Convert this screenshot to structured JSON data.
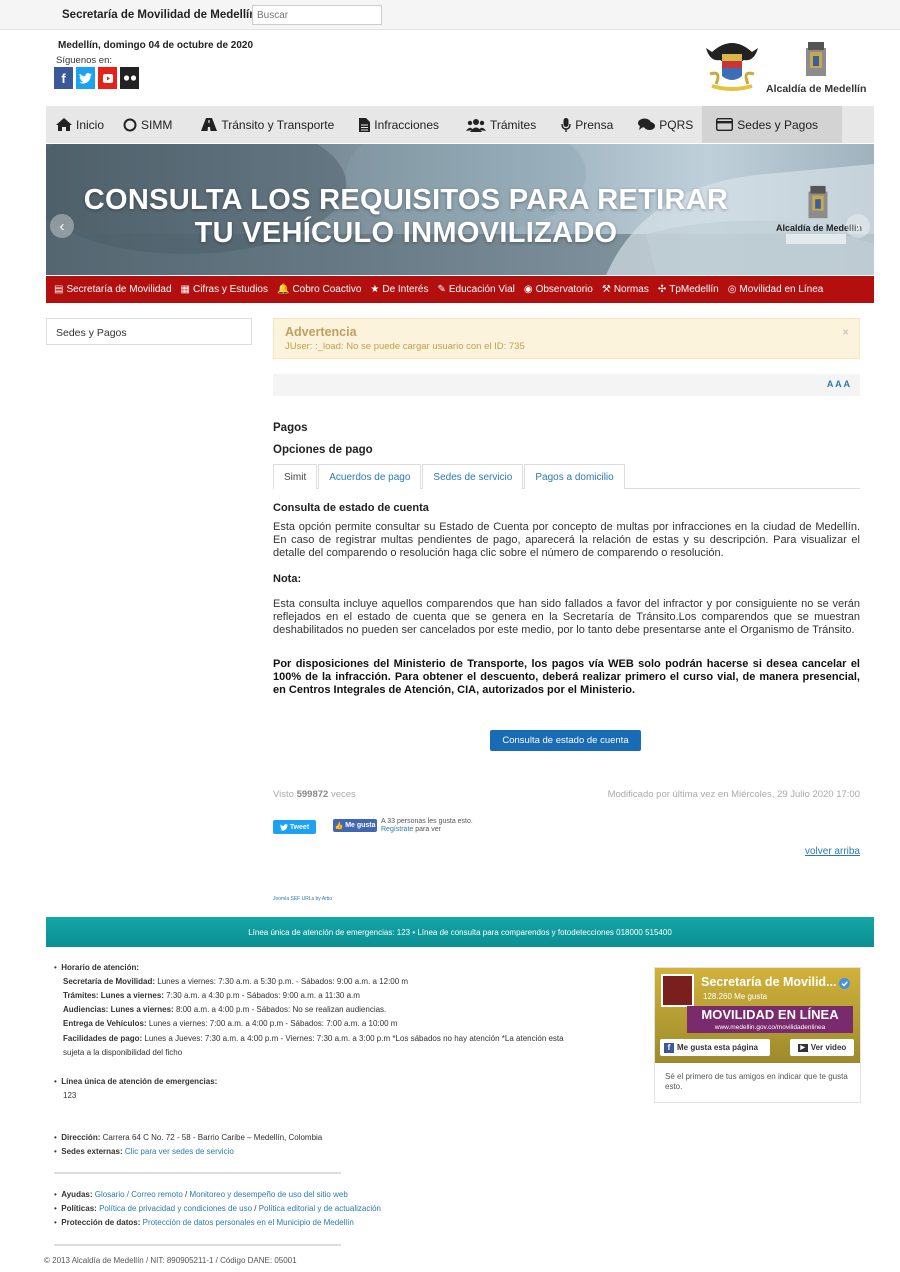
{
  "header": {
    "site_title": "Secretaría de Movilidad de Medellín",
    "search_placeholder": "Buscar",
    "date": "Medellín, domingo 04 de octubre de 2020",
    "siguenos": "Síguenos en:",
    "alcaldia": "Alcaldía de Medellín"
  },
  "nav": {
    "items": [
      {
        "label": "Inicio",
        "icon": "home-icon"
      },
      {
        "label": "SIMM",
        "icon": "circle-icon"
      },
      {
        "label": "Tránsito y Transporte",
        "icon": "road-icon"
      },
      {
        "label": "Infracciones",
        "icon": "document-icon"
      },
      {
        "label": "Trámites",
        "icon": "users-icon"
      },
      {
        "label": "Prensa",
        "icon": "microphone-icon"
      },
      {
        "label": "PQRS",
        "icon": "comments-icon"
      },
      {
        "label": "Sedes y Pagos",
        "icon": "credit-card-icon"
      }
    ]
  },
  "banner": {
    "title_line1": "CONSULTA LOS REQUISITOS PARA RETIRAR",
    "title_line2": "TU VEHÍCULO INMOVILIZADO",
    "logo_label": "Alcaldía de Medellín"
  },
  "subnav": {
    "items": [
      {
        "label": "Secretaría de Movilidad",
        "icon": "▤"
      },
      {
        "label": "Cifras y Estudios",
        "icon": "▦"
      },
      {
        "label": "Cobro Coactivo",
        "icon": "🔔"
      },
      {
        "label": "De Interés",
        "icon": "★"
      },
      {
        "label": "Educación Vial",
        "icon": "✎"
      },
      {
        "label": "Observatorio",
        "icon": "◉"
      },
      {
        "label": "Normas",
        "icon": "⚒"
      },
      {
        "label": "TpMedellín",
        "icon": "✣"
      },
      {
        "label": "Movilidad en Línea",
        "icon": "◎"
      }
    ]
  },
  "sidebar": {
    "label": "Sedes y Pagos"
  },
  "warning": {
    "title": "Advertencia",
    "message": "JUser: :_load: No se puede cargar usuario con el ID: 735",
    "close": "×"
  },
  "fontsize": "A A A",
  "content": {
    "heading": "Pagos",
    "subheading": "Opciones de pago",
    "tabs": [
      "Simit",
      "Acuerdos de pago",
      "Sedes de servicio",
      "Pagos a domicilio"
    ],
    "section_title": "Consulta de estado de cuenta",
    "para1": "Esta opción permite consultar su Estado de Cuenta por concepto de multas por infracciones en la ciudad de Medellín. En caso de registrar multas pendientes de pago, aparecerá  la relación de estas y su descripción. Para visualizar el detalle del comparendo o resolución haga clic sobre el número de comparendo o resolución.",
    "nota_label": "Nota:",
    "para2": "Esta consulta incluye aquellos comparendos que han sido fallados a favor del infractor y por consiguiente no se verán reflejados en el estado de cuenta que se genera en la Secretaría de Tránsito.Los comparendos que se muestran deshabilitados no pueden ser cancelados por este medio, por lo tanto debe presentarse ante el Organismo de Tránsito.",
    "para3": "Por disposiciones del Ministerio de Transporte, los pagos vía WEB solo podrán hacerse si desea cancelar el 100% de la infracción. Para obtener el descuento, deberá realizar primero el curso vial, de manera presencial, en Centros Integrales de Atención, CIA, autorizados por el Ministerio.",
    "cta": "Consulta de estado de cuenta",
    "visto_prefix": "Visto",
    "visto_count": "599872",
    "visto_suffix": "veces",
    "modificado": "Modificado por última vez en Miércoles, 29 Julio 2020 17:00",
    "tweet": "Tweet",
    "like": "Me gusta",
    "like_text_1": "A 33 personas les gusta esto.",
    "like_text_link": "Regístrate",
    "like_text_2": "para ver",
    "volver": "volver arriba",
    "joomla": "Joomla SEF URLs by Artio"
  },
  "footer": {
    "teal_bar": "Línea única de atención de emergencias: 123 • Línea de consulta para comparendos y fotodetecciones 018000 515400",
    "horario_title": "Horario de atención:",
    "horario": [
      {
        "label": "Secretaría de Movilidad:",
        "text": "Lunes a viernes: 7:30 a.m. a 5:30 p.m. - Sábados: 9:00 a.m. a 12:00 m"
      },
      {
        "label": "Trámites: Lunes a viernes:",
        "text": "7:30 a.m. a 4:30 p.m - Sábados: 9:00 a.m. a 11:30 a.m"
      },
      {
        "label": "Audiencias: Lunes a viernes:",
        "text": "8:00 a.m. a 4:00 p.m - Sábados: No se realizan audiencias."
      },
      {
        "label": "Entrega de Vehículos:",
        "text": "Lunes a viernes: 7:00 a.m. a 4:00 p.m - Sábados: 7:00 a.m. a 10:00 m"
      },
      {
        "label": "Facilidades de pago:",
        "text": "Lunes a Jueves: 7:30 a.m. a 4:00 p.m - Viernes: 7:30 a.m. a 3:00 p.m *Los sábados no hay atención *La atención esta"
      },
      {
        "label": "",
        "text": "sujeta a la disponibilidad del ficho"
      }
    ],
    "linea_title": "Línea única de atención de emergencias:",
    "linea_value": "123",
    "direccion_label": "Dirección:",
    "direccion": "Carrera 64 C No. 72 - 58 - Barrio Caribe – Medellín, Colombia",
    "sedes_label": "Sedes externas:",
    "sedes_link": "Clic para ver sedes de servicio",
    "ayudas_label": "Ayudas:",
    "ayudas_links": [
      "Glosario / Correo remoto",
      "Monitoreo y desempeño de uso del sitio web"
    ],
    "politicas_label": "Políticas:",
    "politicas_links": [
      "Política de privacidad y condiciones de uso",
      "Política editorial y de actualización"
    ],
    "proteccion_label": "Protección de datos:",
    "proteccion_link": "Protección de datos personales en el Municipio de Medellín",
    "copyright": "© 2013 Alcaldía de Medellín / NIT: 890905211-1 / Código DANE: 05001"
  },
  "facebook": {
    "name": "Secretaría de Movilid...",
    "likes": "128.260 Me gusta",
    "banner": "MOVILIDAD EN LÍNEA",
    "url": "www.medellin.gov.co/movilidadenlinea",
    "like_btn": "Me gusta esta página",
    "video_btn": "Ver video",
    "friends": "Sé el primero de tus amigos en indicar que te gusta esto."
  },
  "colors": {
    "nav_bg": "#e7e7e7",
    "subnav_red": "#b30f0f",
    "teal": "#0f9c9e",
    "cta_blue": "#1a6bb5",
    "warning_bg": "#fcf3dc"
  }
}
